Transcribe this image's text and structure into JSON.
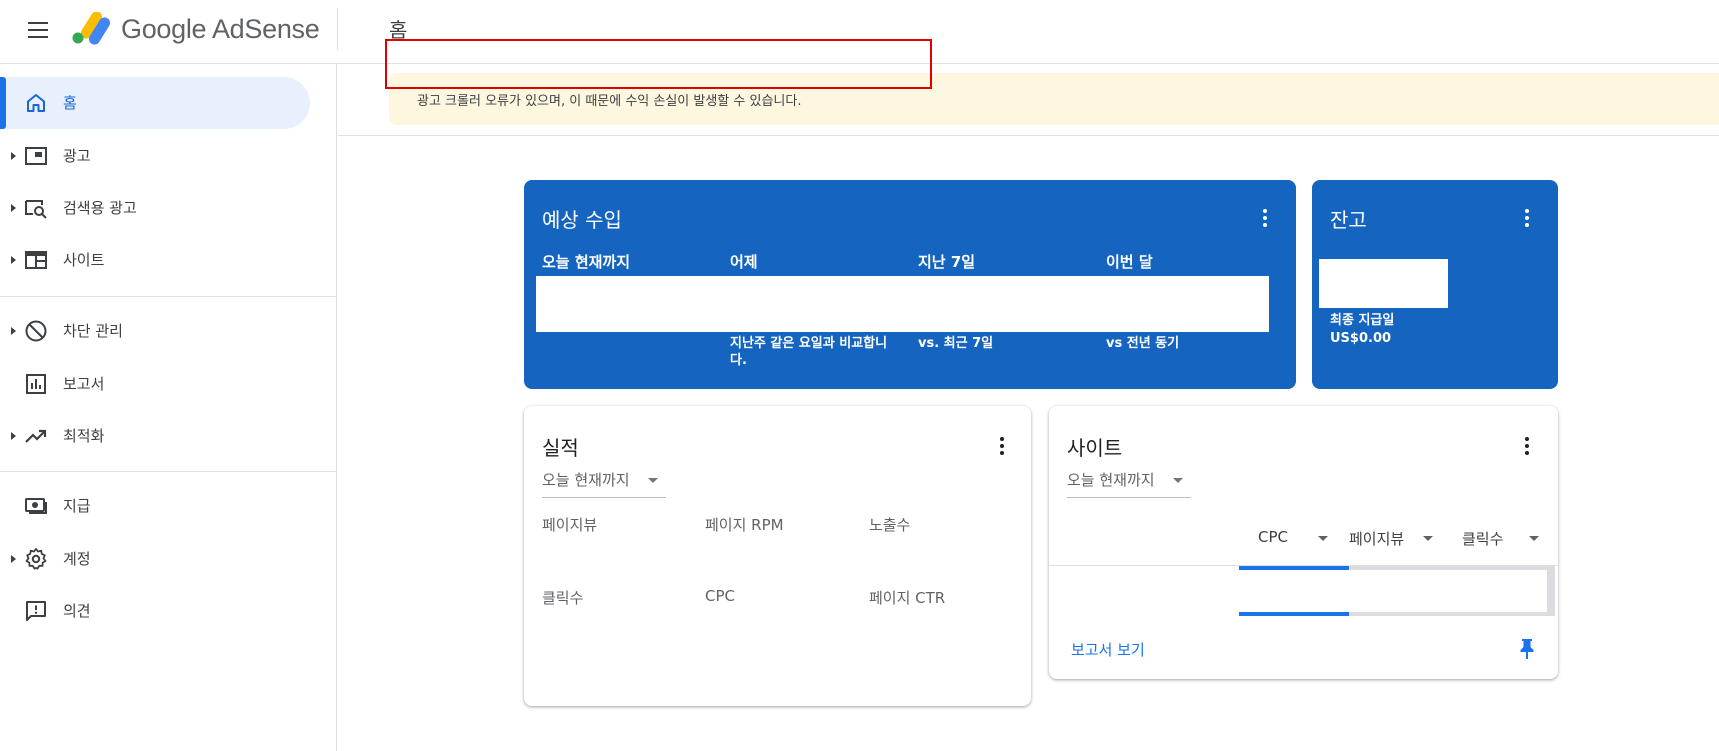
{
  "header": {
    "brand": "Google AdSense",
    "page_title": "홈"
  },
  "sidebar": {
    "items": [
      {
        "label": "홈",
        "icon": "home-icon",
        "active": true
      },
      {
        "label": "광고",
        "icon": "ads-icon"
      },
      {
        "label": "검색용 광고",
        "icon": "search-ads-icon"
      },
      {
        "label": "사이트",
        "icon": "sites-icon"
      },
      {
        "label": "차단 관리",
        "icon": "block-icon"
      },
      {
        "label": "보고서",
        "icon": "reports-icon"
      },
      {
        "label": "최적화",
        "icon": "optimization-icon"
      },
      {
        "label": "지급",
        "icon": "payments-icon"
      },
      {
        "label": "계정",
        "icon": "account-icon"
      },
      {
        "label": "의견",
        "icon": "feedback-icon"
      }
    ]
  },
  "alert": {
    "text": "광고 크롤러 오류가 있으며, 이 때문에 수익 손실이 발생할 수 있습니다."
  },
  "estimated_earnings": {
    "title": "예상 수입",
    "columns": [
      {
        "label": "오늘 현재까지",
        "comparison": ""
      },
      {
        "label": "어제",
        "comparison": "지난주 같은 요일과 비교합니다."
      },
      {
        "label": "지난 7일",
        "comparison": "vs. 최근 7일"
      },
      {
        "label": "이번 달",
        "comparison": "vs 전년 동기"
      }
    ]
  },
  "balance": {
    "title": "잔고",
    "last_payment_label": "최종 지급일",
    "last_payment_value": "US$0.00"
  },
  "performance": {
    "title": "실적",
    "range": "오늘 현재까지",
    "metrics": [
      "페이지뷰",
      "페이지 RPM",
      "노출수",
      "클릭수",
      "CPC",
      "페이지 CTR"
    ]
  },
  "sites": {
    "title": "사이트",
    "range": "오늘 현재까지",
    "columns": [
      "CPC",
      "페이지뷰",
      "클릭수"
    ],
    "rows": [
      {
        "bar_fill_fraction": 0.35
      },
      {
        "bar_fill_fraction": 0.35
      }
    ],
    "report_link": "보고서 보기"
  },
  "colors": {
    "brand_blue": "#1565c0",
    "accent": "#1a73e8",
    "alert_bg": "#fef7e0",
    "active_nav_bg": "#e8f0fe",
    "annotation_red": "#e00000"
  }
}
